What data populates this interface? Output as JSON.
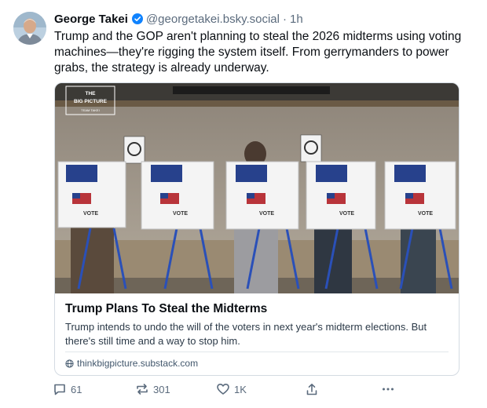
{
  "post": {
    "author": "George Takei",
    "handle": "@georgetakei.bsky.social",
    "separator": "·",
    "time": "1h",
    "text": "Trump and the GOP aren't planning to steal the 2026 midterms using voting machines—they're rigging the system itself. From gerrymanders to power grabs, the strategy is already underway."
  },
  "card": {
    "image_badge": {
      "line1": "THE",
      "line2": "BIG PICTURE",
      "line3": "TEAM TAKEI"
    },
    "booth_label": "VOTE",
    "title": "Trump Plans To Steal the Midterms",
    "description": "Trump intends to undo the will of the voters in next year's midterm elections. But there's still time and a way to stop him.",
    "link": "thinkbigpicture.substack.com"
  },
  "actions": {
    "replies": "61",
    "reposts": "301",
    "likes": "1K"
  },
  "colors": {
    "accent": "#1083fe",
    "muted_text": "#5b6b7d",
    "border": "#d4dbe2"
  }
}
